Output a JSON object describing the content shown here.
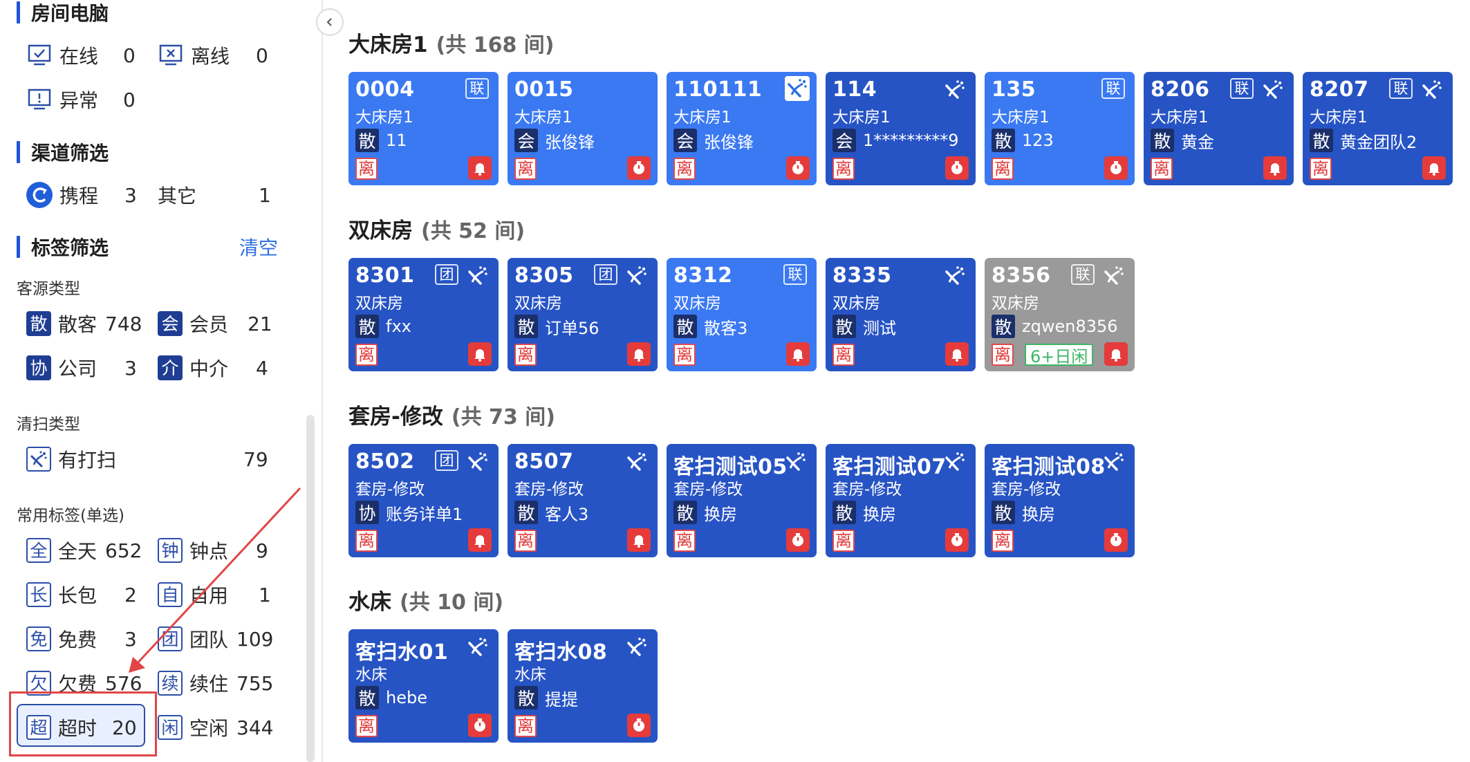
{
  "sidebar": {
    "room_pc": {
      "title": "房间电脑",
      "items": [
        {
          "icon": "monitor-check-icon",
          "label": "在线",
          "count": "0"
        },
        {
          "icon": "monitor-x-icon",
          "label": "离线",
          "count": "0"
        },
        {
          "icon": "monitor-alert-icon",
          "label": "异常",
          "count": "0"
        }
      ]
    },
    "channel": {
      "title": "渠道筛选",
      "items": [
        {
          "icon": "ctrip-logo-icon",
          "label": "携程",
          "count": "3"
        },
        {
          "label": "其它",
          "count": "1"
        }
      ]
    },
    "tags": {
      "title": "标签筛选",
      "clear_label": "清空",
      "guest_type": {
        "title": "客源类型",
        "items": [
          {
            "badge": "散",
            "label": "散客",
            "count": "748"
          },
          {
            "badge": "会",
            "label": "会员",
            "count": "21"
          },
          {
            "badge": "协",
            "label": "公司",
            "count": "3"
          },
          {
            "badge": "介",
            "label": "中介",
            "count": "4"
          }
        ]
      },
      "clean_type": {
        "title": "清扫类型",
        "items": [
          {
            "icon": "cleaning-icon",
            "label": "有打扫",
            "count": "79"
          }
        ]
      },
      "common": {
        "title": "常用标签(单选)",
        "items": [
          {
            "badge": "全",
            "label": "全天",
            "count": "652"
          },
          {
            "badge": "钟",
            "label": "钟点",
            "count": "9"
          },
          {
            "badge": "长",
            "label": "长包",
            "count": "2"
          },
          {
            "badge": "自",
            "label": "自用",
            "count": "1"
          },
          {
            "badge": "免",
            "label": "免费",
            "count": "3"
          },
          {
            "badge": "团",
            "label": "团队",
            "count": "109"
          },
          {
            "badge": "欠",
            "label": "欠费",
            "count": "576"
          },
          {
            "badge": "续",
            "label": "续住",
            "count": "755"
          },
          {
            "badge": "超",
            "label": "超时",
            "count": "20",
            "selected": true
          },
          {
            "badge": "闲",
            "label": "空闲",
            "count": "344"
          }
        ]
      }
    }
  },
  "collapse_icon": "chevron-left-icon",
  "annotation_color": "#e04646",
  "groups": [
    {
      "name": "大床房1",
      "count_text": "(共 168 间)",
      "rooms": [
        {
          "number": "0004",
          "type": "大床房1",
          "guest_badge": "散",
          "guest": "11",
          "leave": "离",
          "link": "联",
          "clean": false,
          "alert": "bell",
          "color": "light"
        },
        {
          "number": "0015",
          "type": "大床房1",
          "guest_badge": "会",
          "guest": "张俊锋",
          "leave": "离",
          "link": "",
          "clean": false,
          "alert": "timer",
          "color": "light"
        },
        {
          "number": "110111",
          "type": "大床房1",
          "guest_badge": "会",
          "guest": "张俊锋",
          "leave": "离",
          "link": "",
          "clean": "boxed",
          "alert": "timer",
          "color": "light"
        },
        {
          "number": "114",
          "type": "大床房1",
          "guest_badge": "会",
          "guest": "1*********9",
          "leave": "离",
          "link": "",
          "clean": true,
          "alert": "timer",
          "color": "dark"
        },
        {
          "number": "135",
          "type": "大床房1",
          "guest_badge": "散",
          "guest": "123",
          "leave": "离",
          "link": "联",
          "clean": false,
          "alert": "timer",
          "color": "light"
        },
        {
          "number": "8206",
          "type": "大床房1",
          "guest_badge": "散",
          "guest": "黄金",
          "leave": "离",
          "link": "联",
          "clean": true,
          "alert": "bell",
          "color": "dark"
        },
        {
          "number": "8207",
          "type": "大床房1",
          "guest_badge": "散",
          "guest": "黄金团队2",
          "leave": "离",
          "link": "联",
          "clean": true,
          "alert": "bell",
          "color": "dark"
        }
      ]
    },
    {
      "name": "双床房",
      "count_text": "(共 52 间)",
      "rooms": [
        {
          "number": "8301",
          "type": "双床房",
          "guest_badge": "散",
          "guest": "fxx",
          "leave": "离",
          "link": "团",
          "clean": true,
          "alert": "bell",
          "color": "dark"
        },
        {
          "number": "8305",
          "type": "双床房",
          "guest_badge": "散",
          "guest": "订单56",
          "leave": "离",
          "link": "团",
          "clean": true,
          "alert": "bell",
          "color": "dark"
        },
        {
          "number": "8312",
          "type": "双床房",
          "guest_badge": "散",
          "guest": "散客3",
          "leave": "离",
          "link": "联",
          "clean": false,
          "alert": "bell",
          "color": "light"
        },
        {
          "number": "8335",
          "type": "双床房",
          "guest_badge": "散",
          "guest": "测试",
          "leave": "离",
          "link": "",
          "clean": true,
          "alert": "bell",
          "color": "dark"
        },
        {
          "number": "8356",
          "type": "双床房",
          "guest_badge": "散",
          "guest": "zqwen8356",
          "leave": "离",
          "idle": "6+日闲",
          "link": "联",
          "clean": true,
          "alert": "bell",
          "color": "gray"
        }
      ]
    },
    {
      "name": "套房-修改",
      "count_text": "(共 73 间)",
      "rooms": [
        {
          "number": "8502",
          "type": "套房-修改",
          "guest_badge": "协",
          "guest": "账务详单1",
          "leave": "离",
          "link": "团",
          "clean": true,
          "alert": "bell",
          "color": "dark"
        },
        {
          "number": "8507",
          "type": "套房-修改",
          "guest_badge": "散",
          "guest": "客人3",
          "leave": "离",
          "link": "",
          "clean": true,
          "alert": "bell",
          "color": "dark"
        },
        {
          "number": "客扫测试05",
          "type": "套房-修改",
          "guest_badge": "散",
          "guest": "换房",
          "leave": "离",
          "link": "",
          "clean": true,
          "alert": "timer",
          "color": "dark"
        },
        {
          "number": "客扫测试07",
          "type": "套房-修改",
          "guest_badge": "散",
          "guest": "换房",
          "leave": "离",
          "link": "",
          "clean": true,
          "alert": "timer",
          "color": "dark"
        },
        {
          "number": "客扫测试08",
          "type": "套房-修改",
          "guest_badge": "散",
          "guest": "换房",
          "leave": "离",
          "link": "",
          "clean": true,
          "alert": "timer",
          "color": "dark"
        }
      ]
    },
    {
      "name": "水床",
      "count_text": "(共 10 间)",
      "rooms": [
        {
          "number": "客扫水01",
          "type": "水床",
          "guest_badge": "散",
          "guest": "hebe",
          "leave": "离",
          "link": "",
          "clean": true,
          "alert": "timer",
          "color": "dark"
        },
        {
          "number": "客扫水08",
          "type": "水床",
          "guest_badge": "散",
          "guest": "提提",
          "leave": "离",
          "link": "",
          "clean": true,
          "alert": "timer",
          "color": "dark"
        }
      ]
    }
  ]
}
